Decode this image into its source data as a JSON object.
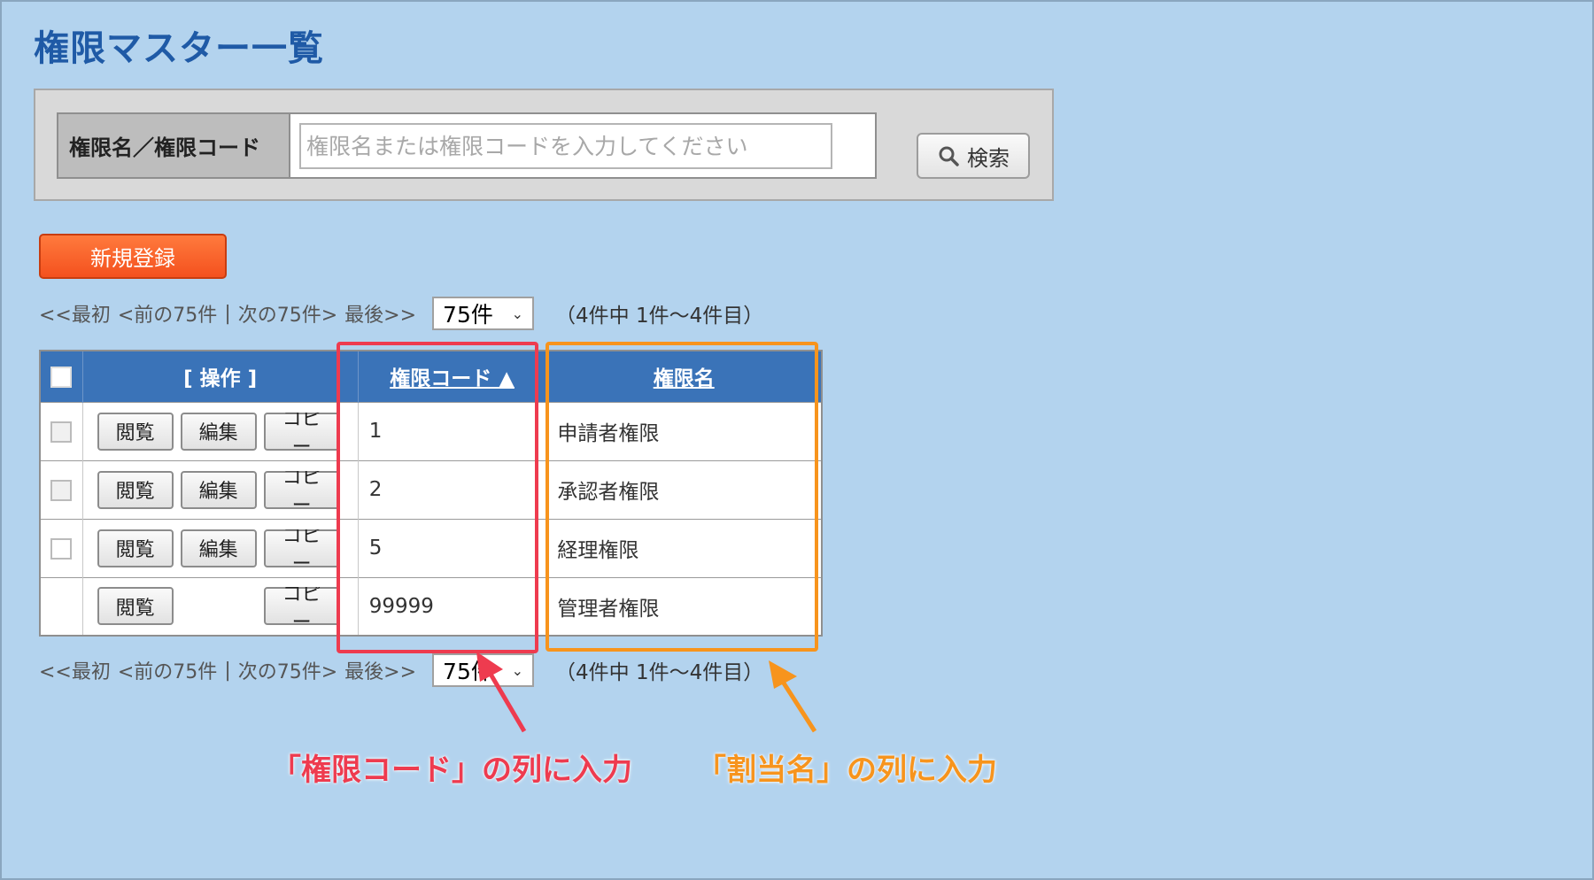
{
  "page": {
    "title": "権限マスター一覧"
  },
  "search": {
    "label": "権限名／権限コード",
    "placeholder": "権限名または権限コードを入力してください",
    "button_label": "検索"
  },
  "actions": {
    "new_label": "新規登録"
  },
  "pager": {
    "first": "<<最初",
    "prev": "<前の75件",
    "separator": "|",
    "next": "次の75件>",
    "last": "最後>>",
    "page_size": "75件",
    "count_text": "（4件中 1件〜4件目）"
  },
  "table": {
    "headers": {
      "ops": "[ 操作 ]",
      "code": "権限コード ▲",
      "name": "権限名"
    },
    "button_labels": {
      "view": "閲覧",
      "edit": "編集",
      "copy": "コピー"
    },
    "rows": [
      {
        "code": "1",
        "name": "申請者権限",
        "checkbox": true,
        "editable": true
      },
      {
        "code": "2",
        "name": "承認者権限",
        "checkbox": true,
        "editable": true
      },
      {
        "code": "5",
        "name": "経理権限",
        "checkbox": true,
        "editable": true
      },
      {
        "code": "99999",
        "name": "管理者権限",
        "checkbox": false,
        "editable": false
      }
    ]
  },
  "annotations": {
    "red": "「権限コード」の列に入力",
    "orange": "「割当名」の列に入力"
  },
  "colors": {
    "background": "#b3d3ee",
    "title": "#1f5aa6",
    "table_header": "#3a73b8",
    "new_button": "#f4511e",
    "highlight_red": "#ee3b4f",
    "highlight_orange": "#f7941d"
  }
}
